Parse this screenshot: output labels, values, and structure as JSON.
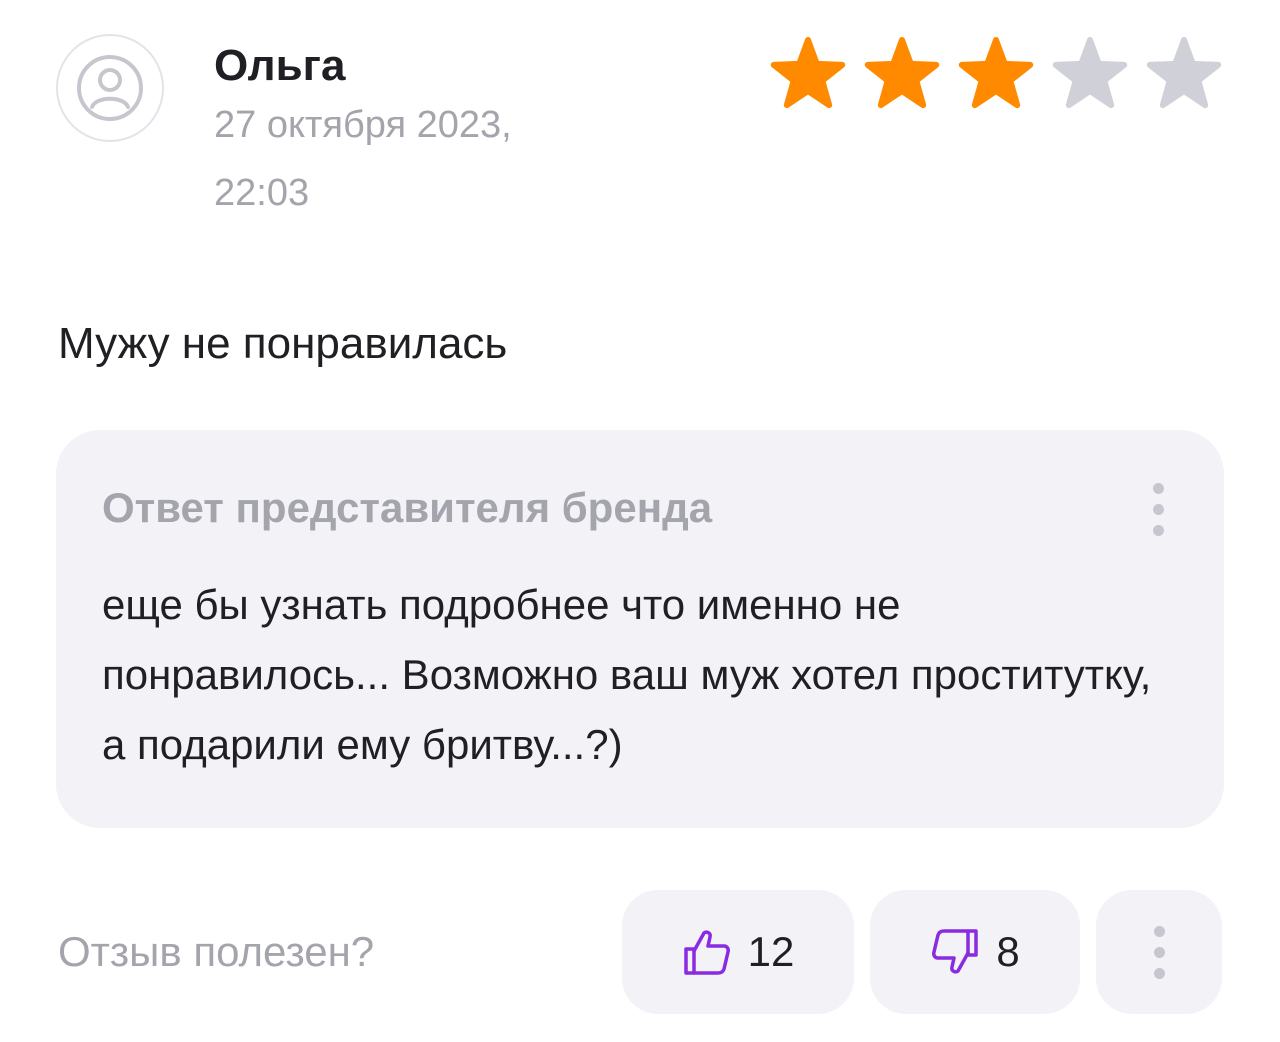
{
  "review": {
    "author": "Ольга",
    "date": "27 октября 2023,",
    "time": "22:03",
    "rating": 3,
    "max_rating": 5,
    "text": "Мужу не понравилась"
  },
  "brand_reply": {
    "title": "Ответ представителя бренда",
    "text": "еще бы узнать подробнее что именно не понравилось... Возможно ваш муж хотел проститутку, а подарили ему бритву...?)"
  },
  "feedback": {
    "label": "Отзыв полезен?",
    "likes": "12",
    "dislikes": "8"
  },
  "icons": {
    "avatar": "user-avatar-icon",
    "star": "star-icon",
    "like": "thumbs-up-icon",
    "dislike": "thumbs-down-icon",
    "more": "vertical-dots-icon"
  },
  "colors": {
    "star_filled": "#FF8A00",
    "star_empty": "#D0D0D8",
    "accent": "#8A2BE2",
    "muted_text": "#A4A4AD",
    "panel_bg": "#F2F2F7"
  }
}
